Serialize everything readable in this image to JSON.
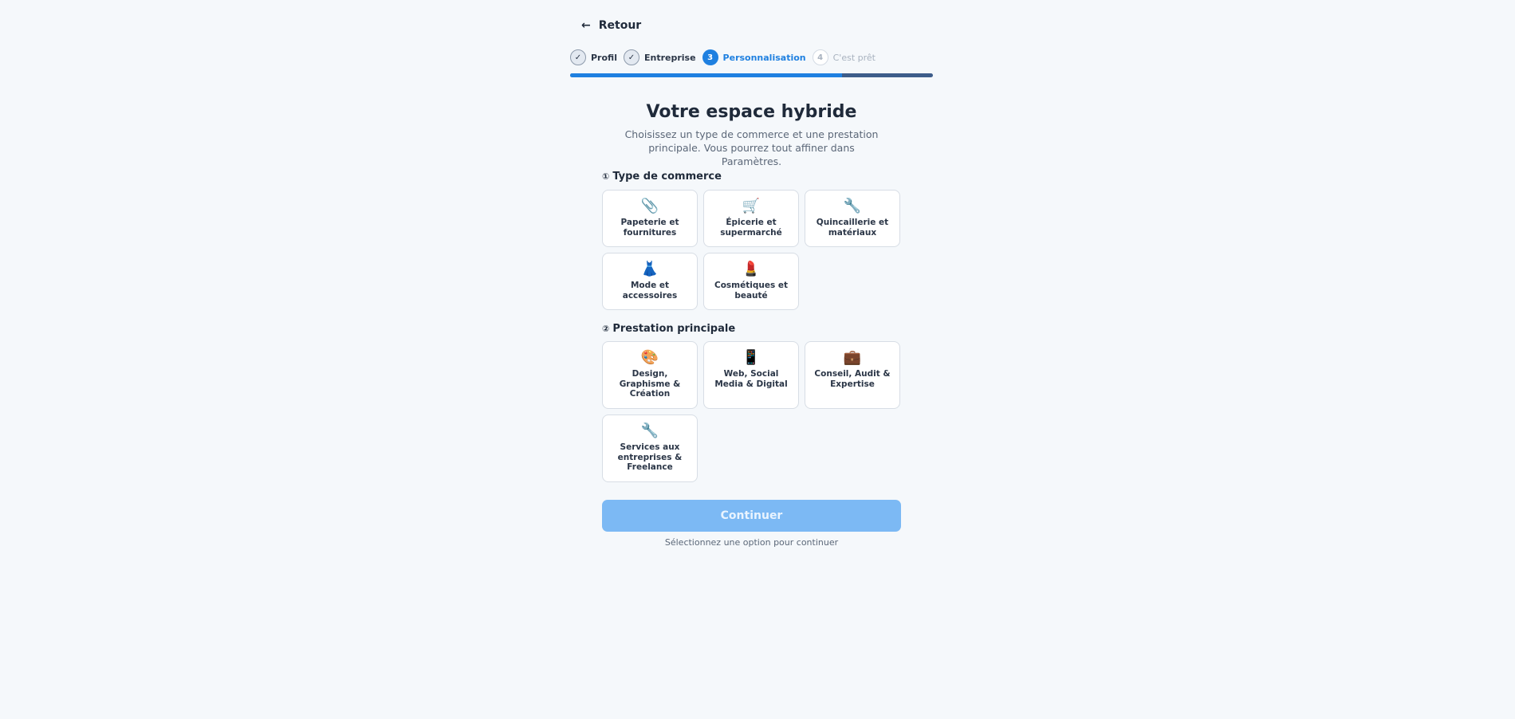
{
  "back": {
    "label": "Retour"
  },
  "stepper": {
    "steps": [
      {
        "marker": "✓",
        "label": "Profil"
      },
      {
        "marker": "✓",
        "label": "Entreprise"
      },
      {
        "marker": "3",
        "label": "Personnalisation"
      },
      {
        "marker": "4",
        "label": "C'est prêt"
      }
    ],
    "progress_fraction": 0.75
  },
  "header": {
    "title": "Votre espace hybride",
    "subtitle": "Choisissez un type de commerce et une prestation principale. Vous pourrez tout affiner dans Paramètres."
  },
  "section1": {
    "number": "①",
    "label": "Type de commerce",
    "options": [
      {
        "icon": "paperclip-icon",
        "glyph": "📎",
        "label": "Papeterie et fournitures"
      },
      {
        "icon": "shopping-cart-icon",
        "glyph": "🛒",
        "label": "Épicerie et supermarché"
      },
      {
        "icon": "wrench-icon",
        "glyph": "🔧",
        "label": "Quincaillerie et matériaux"
      },
      {
        "icon": "dress-icon",
        "glyph": "👗",
        "label": "Mode et accessoires"
      },
      {
        "icon": "lipstick-icon",
        "glyph": "💄",
        "label": "Cosmétiques et beauté"
      }
    ]
  },
  "section2": {
    "number": "②",
    "label": "Prestation principale",
    "options": [
      {
        "icon": "palette-icon",
        "glyph": "🎨",
        "label": "Design, Graphisme & Création"
      },
      {
        "icon": "mobile-phone-icon",
        "glyph": "📱",
        "label": "Web, Social Media & Digital"
      },
      {
        "icon": "briefcase-icon",
        "glyph": "💼",
        "label": "Conseil, Audit & Expertise"
      },
      {
        "icon": "wrench-icon",
        "glyph": "🔧",
        "label": "Services aux entreprises & Freelance"
      }
    ]
  },
  "continue_button": {
    "label": "Continuer"
  },
  "hint": "Sélectionnez une option pour continuer",
  "colors": {
    "accent": "#1f80e0",
    "button_disabled": "#7cb9f4",
    "background": "#f5f8fb"
  }
}
